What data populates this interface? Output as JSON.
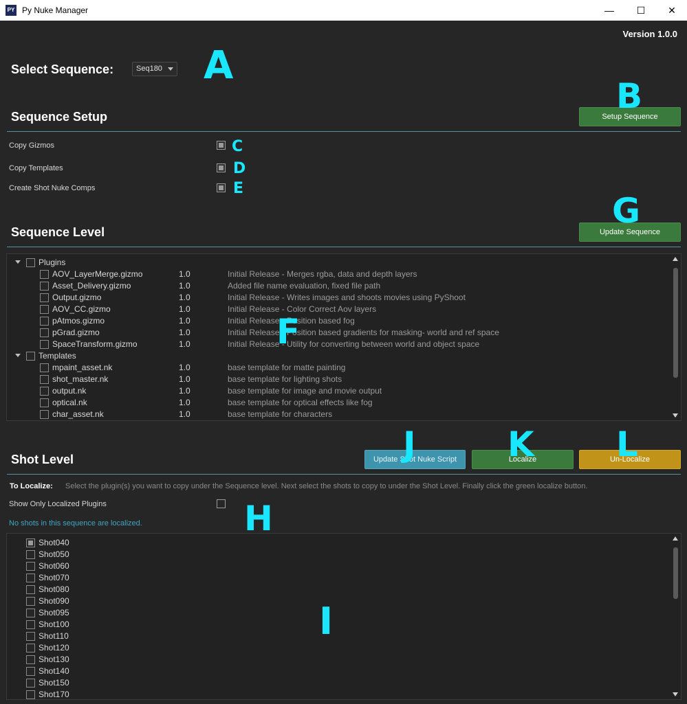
{
  "window": {
    "title": "Py Nuke Manager",
    "icon_text": "PY",
    "minimize": "—",
    "maximize": "☐",
    "close": "✕"
  },
  "version": "Version 1.0.0",
  "select_sequence": {
    "label": "Select Sequence:",
    "value": "Seq180"
  },
  "sequence_setup": {
    "title": "Sequence Setup",
    "button": "Setup Sequence",
    "options": [
      {
        "label": "Copy Gizmos",
        "checked": true
      },
      {
        "label": "Copy Templates",
        "checked": true
      },
      {
        "label": "Create Shot Nuke Comps",
        "checked": true
      }
    ]
  },
  "sequence_level": {
    "title": "Sequence Level",
    "button": "Update Sequence",
    "categories": [
      {
        "name": "Plugins",
        "items": [
          {
            "name": "AOV_LayerMerge.gizmo",
            "version": "1.0",
            "desc": "Initial Release - Merges rgba, data and depth layers"
          },
          {
            "name": "Asset_Delivery.gizmo",
            "version": "1.0",
            "desc": "Added file name evaluation, fixed file path"
          },
          {
            "name": "Output.gizmo",
            "version": "1.0",
            "desc": "Initial Release - Writes images and shoots movies using PyShoot"
          },
          {
            "name": "AOV_CC.gizmo",
            "version": "1.0",
            "desc": "Initial Release - Color Correct Aov layers"
          },
          {
            "name": "pAtmos.gizmo",
            "version": "1.0",
            "desc": "Initial Release - Position based fog"
          },
          {
            "name": "pGrad.gizmo",
            "version": "1.0",
            "desc": "Initial Release - Position based gradients for masking-  world and ref space"
          },
          {
            "name": "SpaceTransform.gizmo",
            "version": "1.0",
            "desc": "Initial Release - Utility for converting between world and object space"
          }
        ]
      },
      {
        "name": "Templates",
        "items": [
          {
            "name": "mpaint_asset.nk",
            "version": "1.0",
            "desc": "base template for matte painting"
          },
          {
            "name": "shot_master.nk",
            "version": "1.0",
            "desc": "base template for lighting shots"
          },
          {
            "name": "output.nk",
            "version": "1.0",
            "desc": "base template for image and movie output"
          },
          {
            "name": "optical.nk",
            "version": "1.0",
            "desc": "base template for optical effects like fog"
          },
          {
            "name": "char_asset.nk",
            "version": "1.0",
            "desc": "base template for characters"
          }
        ]
      }
    ]
  },
  "shot_level": {
    "title": "Shot Level",
    "buttons": {
      "update": "Update Shot Nuke Script",
      "localize": "Localize",
      "unlocalize": "Un-Localize"
    },
    "hint_label": "To Localize:",
    "hint_text": "Select the plugin(s) you want to copy under the Sequence level. Next select the shots to copy to under the Shot Level. Finally click the green localize button.",
    "show_only_label": "Show Only Localized Plugins",
    "show_only_checked": false,
    "status": "No shots in this sequence are localized.",
    "shots": [
      {
        "name": "Shot040",
        "checked": true
      },
      {
        "name": "Shot050",
        "checked": false
      },
      {
        "name": "Shot060",
        "checked": false
      },
      {
        "name": "Shot070",
        "checked": false
      },
      {
        "name": "Shot080",
        "checked": false
      },
      {
        "name": "Shot090",
        "checked": false
      },
      {
        "name": "Shot095",
        "checked": false
      },
      {
        "name": "Shot100",
        "checked": false
      },
      {
        "name": "Shot110",
        "checked": false
      },
      {
        "name": "Shot120",
        "checked": false
      },
      {
        "name": "Shot130",
        "checked": false
      },
      {
        "name": "Shot140",
        "checked": false
      },
      {
        "name": "Shot150",
        "checked": false
      },
      {
        "name": "Shot170",
        "checked": false
      }
    ]
  },
  "annotations": [
    "A",
    "B",
    "C",
    "D",
    "E",
    "F",
    "G",
    "H",
    "I",
    "J",
    "K",
    "L"
  ],
  "colors": {
    "background": "#262626",
    "accent_line": "#5a8fa0",
    "green_button": "#3a7a3c",
    "blue_button": "#3e93ad",
    "yellow_button": "#c19419",
    "annotation": "#19e6ff",
    "status_text": "#3fa6c4"
  }
}
